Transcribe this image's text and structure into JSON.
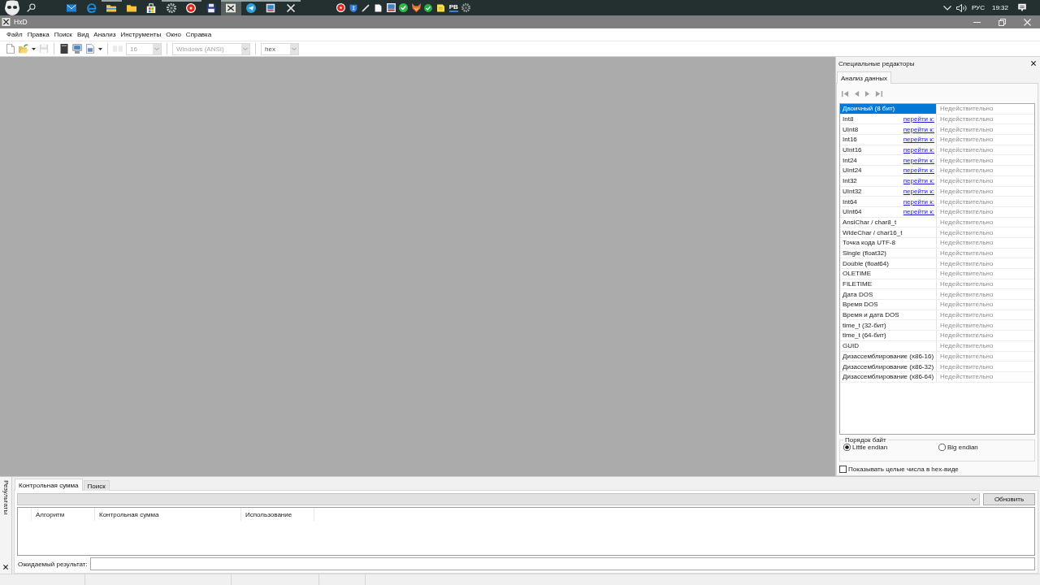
{
  "taskbar": {
    "apps": [
      {
        "running": false,
        "selected": false
      },
      {
        "running": false,
        "selected": false
      },
      {
        "running": true,
        "selected": false
      },
      {
        "running": false,
        "selected": false
      },
      {
        "running": false,
        "selected": false
      },
      {
        "running": true,
        "selected": false
      },
      {
        "running": true,
        "selected": false
      },
      {
        "running": false,
        "selected": false
      },
      {
        "running": true,
        "selected": true
      },
      {
        "running": true,
        "selected": false
      },
      {
        "running": true,
        "selected": false
      },
      {
        "running": true,
        "selected": false
      }
    ],
    "tray_icon_label": "PB",
    "language": "РУС",
    "time": "19:32"
  },
  "window": {
    "title": "HxD"
  },
  "menu": [
    "Файл",
    "Правка",
    "Поиск",
    "Вид",
    "Анализ",
    "Инструменты",
    "Окно",
    "Справка"
  ],
  "toolbar": {
    "buttons": [
      {
        "disabled": false
      },
      {
        "disabled": false
      },
      {
        "disabled": true
      },
      {
        "disabled": false
      },
      {
        "disabled": false
      },
      {
        "disabled": false
      },
      {
        "disabled": true
      }
    ],
    "bytes_per_row": {
      "value": "16",
      "disabled": true
    },
    "encoding": {
      "value": "Windows (ANSI)",
      "disabled": true
    },
    "offset_base": {
      "value": "hex",
      "disabled": false
    }
  },
  "special_editors": {
    "title": "Специальные редакторы",
    "tabs": [
      {
        "label": "Анализ данных",
        "selected": true
      }
    ],
    "rows": [
      {
        "type": "Двоичный (8 бит)",
        "value": "Недействительно",
        "selected": true
      },
      {
        "type": "Int8",
        "link": "перейти к:",
        "value": "Недействительно",
        "selected": false
      },
      {
        "type": "UInt8",
        "link": "перейти к:",
        "value": "Недействительно",
        "selected": false
      },
      {
        "type": "Int16",
        "link": "перейти к:",
        "value": "Недействительно",
        "selected": false
      },
      {
        "type": "UInt16",
        "link": "перейти к:",
        "value": "Недействительно",
        "selected": false
      },
      {
        "type": "Int24",
        "link": "перейти к:",
        "value": "Недействительно",
        "selected": false
      },
      {
        "type": "UInt24",
        "link": "перейти к:",
        "value": "Недействительно",
        "selected": false
      },
      {
        "type": "Int32",
        "link": "перейти к:",
        "value": "Недействительно",
        "selected": false
      },
      {
        "type": "UInt32",
        "link": "перейти к:",
        "value": "Недействительно",
        "selected": false
      },
      {
        "type": "Int64",
        "link": "перейти к:",
        "value": "Недействительно",
        "selected": false
      },
      {
        "type": "UInt64",
        "link": "перейти к:",
        "value": "Недействительно",
        "selected": false
      },
      {
        "type": "AnsiChar / char8_t",
        "value": "Недействительно",
        "selected": false
      },
      {
        "type": "WideChar / char16_t",
        "value": "Недействительно",
        "selected": false
      },
      {
        "type": "Точка кода UTF-8",
        "value": "Недействительно",
        "selected": false
      },
      {
        "type": "Single (float32)",
        "value": "Недействительно",
        "selected": false
      },
      {
        "type": "Double (float64)",
        "value": "Недействительно",
        "selected": false
      },
      {
        "type": "OLETIME",
        "value": "Недействительно",
        "selected": false
      },
      {
        "type": "FILETIME",
        "value": "Недействительно",
        "selected": false
      },
      {
        "type": "Дата DOS",
        "value": "Недействительно",
        "selected": false
      },
      {
        "type": "Время DOS",
        "value": "Недействительно",
        "selected": false
      },
      {
        "type": "Время и дата DOS",
        "value": "Недействительно",
        "selected": false
      },
      {
        "type": "time_t (32-бит)",
        "value": "Недействительно",
        "selected": false
      },
      {
        "type": "time_t (64-бит)",
        "value": "Недействительно",
        "selected": false
      },
      {
        "type": "GUID",
        "value": "Недействительно",
        "selected": false
      },
      {
        "type": "Дизассемблирование (x86-16)",
        "value": "Недействительно",
        "selected": false
      },
      {
        "type": "Дизассемблирование (x86-32)",
        "value": "Недействительно",
        "selected": false
      },
      {
        "type": "Дизассемблирование (x86-64)",
        "value": "Недействительно",
        "selected": false
      }
    ],
    "byte_order": {
      "title": "Порядок байт",
      "options": [
        {
          "label": "Little endian",
          "selected": true
        },
        {
          "label": "Big endian",
          "selected": false
        }
      ]
    },
    "hex_integers": {
      "label": "Показывать целые числа в hex-виде",
      "checked": false
    }
  },
  "results": {
    "side_tab": "Результаты",
    "tabs": [
      {
        "label": "Контрольная сумма",
        "selected": true
      },
      {
        "label": "Поиск",
        "selected": false
      }
    ],
    "refresh_button": "Обновить",
    "columns": [
      "Алгоритм",
      "Контрольная сумма",
      "Использование"
    ],
    "expected_label": "Ожидаемый результат:"
  }
}
